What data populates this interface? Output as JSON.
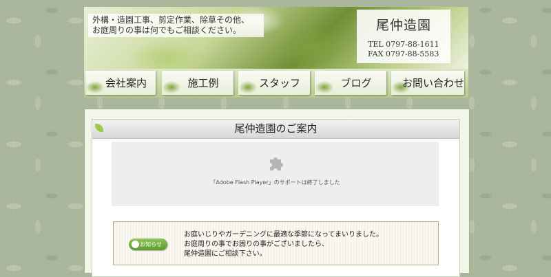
{
  "header": {
    "intro_line1": "外構・造園工事、剪定作業、除草その他、",
    "intro_line2": "お庭周りの事は何でもご相談ください。",
    "company_name": "尾仲造園",
    "tel": "TEL 0797-88-1611",
    "fax": "FAX 0797-88-5583"
  },
  "nav": {
    "items": [
      {
        "label": "会社案内"
      },
      {
        "label": "施工例"
      },
      {
        "label": "スタッフ"
      },
      {
        "label": "ブログ"
      },
      {
        "label": "お問い合わせ"
      }
    ]
  },
  "main": {
    "section_title": "尾仲造園のご案内",
    "flash_message": "「Adobe Flash Player」のサポートは終了しました",
    "notice": {
      "badge_label": "お知らせ",
      "line1": "お庭いじりやガーデニングに最適な季節になってまいりました。",
      "line2": "お庭周りの事でお困りの事がございましたら、",
      "line3": "尾仲造園にご相談下さい。"
    }
  }
}
